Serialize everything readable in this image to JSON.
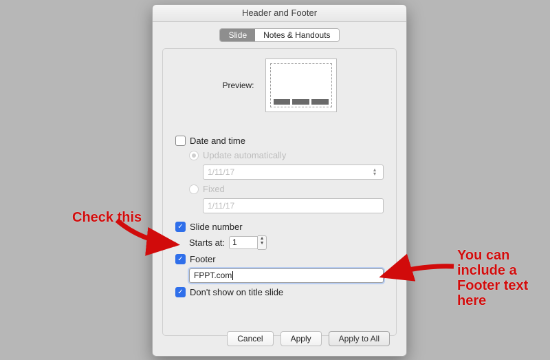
{
  "title": "Header and Footer",
  "tabs": {
    "slide": "Slide",
    "notes": "Notes & Handouts"
  },
  "preview_label": "Preview:",
  "date": {
    "label": "Date and time",
    "auto_label": "Update automatically",
    "auto_value": "1/11/17",
    "fixed_label": "Fixed",
    "fixed_placeholder": "1/11/17"
  },
  "slidenum": {
    "label": "Slide number",
    "starts_label": "Starts at:",
    "starts_value": "1"
  },
  "footer": {
    "label": "Footer",
    "value": "FPPT.com"
  },
  "dontshow": "Don't show on title slide",
  "buttons": {
    "cancel": "Cancel",
    "apply": "Apply",
    "applyall": "Apply to All"
  },
  "anno1": "Check this",
  "anno2": "You can\ninclude a\nFooter text\nhere"
}
